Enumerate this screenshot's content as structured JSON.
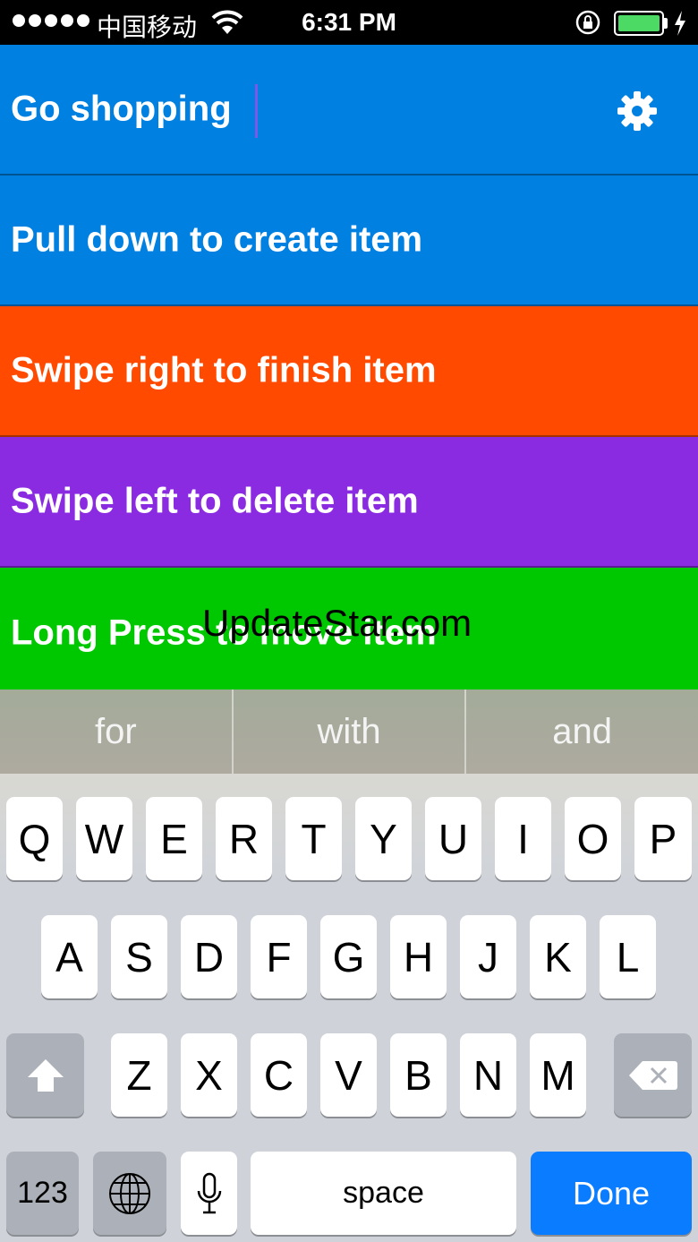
{
  "status_bar": {
    "carrier": "中国移动",
    "time": "6:31 PM"
  },
  "list": {
    "title": "Go shopping",
    "items": [
      {
        "label": "Pull down to create item",
        "color": "#0080e0"
      },
      {
        "label": "Swipe right to finish item",
        "color": "#ff4a00"
      },
      {
        "label": "Swipe left to delete item",
        "color": "#8a2be2"
      },
      {
        "label": "Long Press to move item",
        "color": "#00c800"
      }
    ]
  },
  "watermark": "UpdateStar.com",
  "suggestions": [
    "for",
    "with",
    "and"
  ],
  "keyboard": {
    "row1": [
      "Q",
      "W",
      "E",
      "R",
      "T",
      "Y",
      "U",
      "I",
      "O",
      "P"
    ],
    "row2": [
      "A",
      "S",
      "D",
      "F",
      "G",
      "H",
      "J",
      "K",
      "L"
    ],
    "row3": [
      "Z",
      "X",
      "C",
      "V",
      "B",
      "N",
      "M"
    ],
    "numbers_label": "123",
    "space_label": "space",
    "done_label": "Done"
  }
}
